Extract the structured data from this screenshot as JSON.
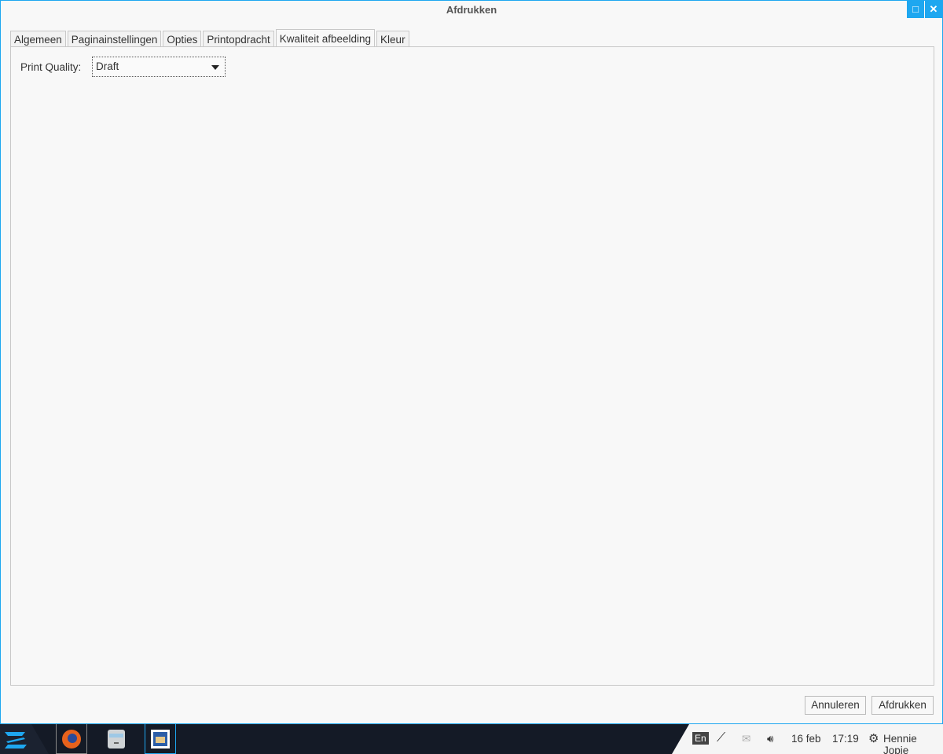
{
  "window": {
    "title": "Afdrukken",
    "maximize_icon": "maximize-icon",
    "close_icon": "close-icon"
  },
  "tabs": [
    {
      "label": "Algemeen"
    },
    {
      "label": "Paginainstellingen"
    },
    {
      "label": "Opties"
    },
    {
      "label": "Printopdracht"
    },
    {
      "label": "Kwaliteit afbeelding"
    },
    {
      "label": "Kleur"
    }
  ],
  "active_tab": "Kwaliteit afbeelding",
  "print_quality": {
    "label": "Print Quality:",
    "value": "Draft"
  },
  "buttons": {
    "cancel": "Annuleren",
    "print": "Afdrukken"
  },
  "taskbar": {
    "keyboard_layout": "En",
    "date": "16 feb",
    "time": "17:19",
    "user": "Hennie Jopie"
  },
  "colors": {
    "accent": "#1ea7f0",
    "taskbar": "#141a26"
  }
}
